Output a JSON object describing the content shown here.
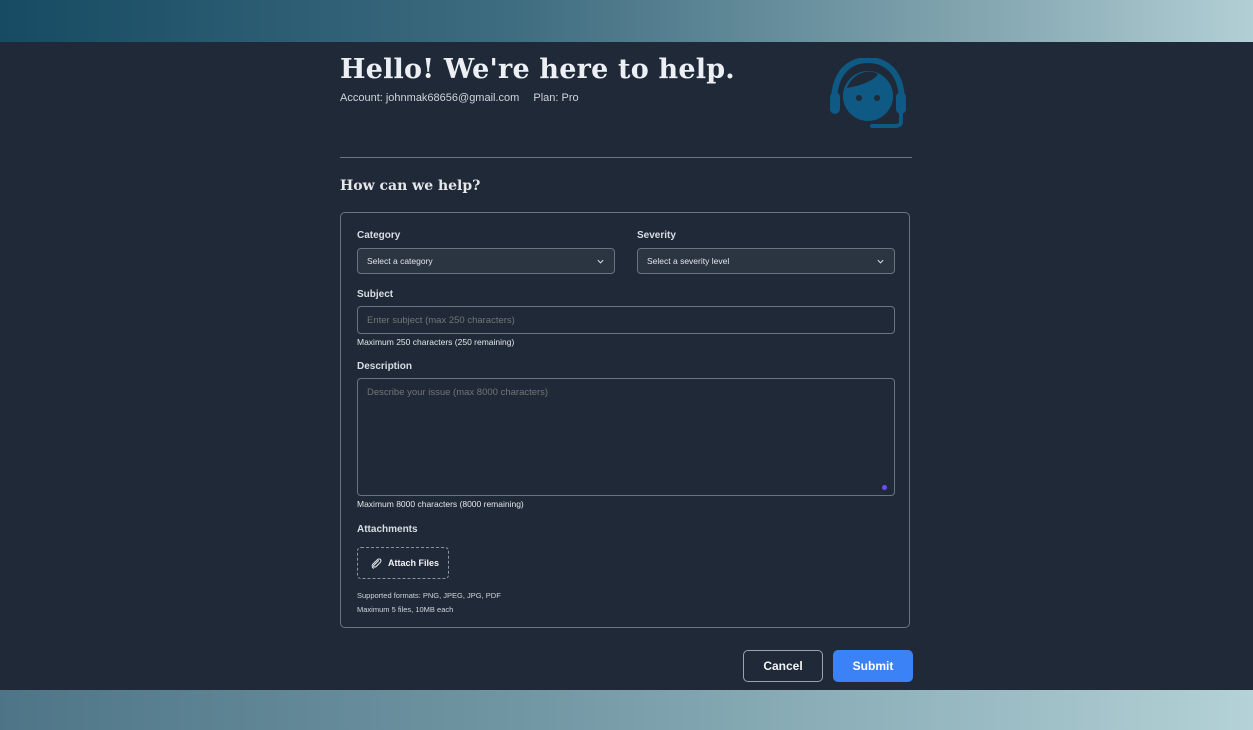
{
  "header": {
    "greeting": "Hello! We're here to help.",
    "account_label": "Account: johnmak68656@gmail.com",
    "plan_label": "Plan: Pro",
    "icon": "support-agent-icon"
  },
  "form": {
    "title": "How can we help?",
    "category": {
      "label": "Category",
      "placeholder": "Select a category"
    },
    "severity": {
      "label": "Severity",
      "placeholder": "Select a severity level"
    },
    "subject": {
      "label": "Subject",
      "placeholder": "Enter subject (max 250 characters)",
      "value": "",
      "hint": "Maximum 250 characters (250 remaining)"
    },
    "description": {
      "label": "Description",
      "placeholder": "Describe your issue (max 8000 characters)",
      "value": "",
      "hint": "Maximum 8000 characters (8000 remaining)"
    },
    "attachments": {
      "label": "Attachments",
      "button": "Attach Files",
      "formats": "Supported formats: PNG, JPEG, JPG, PDF",
      "limits": "Maximum 5 files, 10MB each"
    }
  },
  "actions": {
    "cancel": "Cancel",
    "submit": "Submit"
  },
  "colors": {
    "background": "#1f2937",
    "accent_blue": "#3b82f6",
    "icon_blue": "#0e5a85",
    "resize_handle": "#6d4cff"
  }
}
